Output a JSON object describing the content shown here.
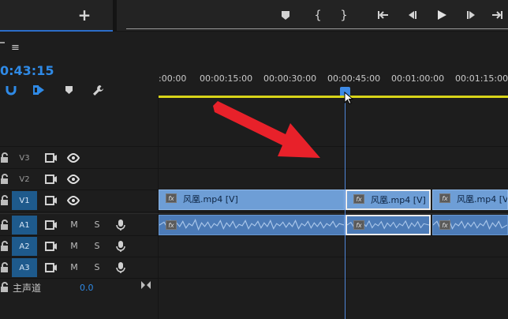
{
  "toolbar": {
    "add_glyph": "+",
    "marker_glyph": "⬥",
    "mark_in_glyph": "{",
    "mark_out_glyph": "}",
    "goto_in_glyph": "{←",
    "step_back_glyph": "◀|",
    "play_glyph": "▶",
    "step_forward_glyph": "|▶",
    "goto_out_glyph": "→}"
  },
  "timeline": {
    "menu_glyph": "≡",
    "timecode": "0:43:15",
    "ruler_labels": [
      ":00:00",
      "00:00:15:00",
      "00:00:30:00",
      "00:00:45:00",
      "00:01:00:00",
      "00:01:15:00"
    ]
  },
  "tracks": {
    "video": [
      {
        "name": "V3",
        "targeted": false
      },
      {
        "name": "V2",
        "targeted": false
      },
      {
        "name": "V1",
        "targeted": true
      }
    ],
    "audio": [
      {
        "name": "A1",
        "mute": "M",
        "solo": "S"
      },
      {
        "name": "A2",
        "mute": "M",
        "solo": "S"
      },
      {
        "name": "A3",
        "mute": "M",
        "solo": "S"
      }
    ],
    "master": {
      "label": "主声道",
      "value": "0.0"
    }
  },
  "clips": {
    "video": [
      {
        "label": "风凰.mp4 [V]",
        "fx": "fx"
      },
      {
        "label": "风凰.mp4 [V]",
        "fx": "fx"
      },
      {
        "label": "风凰.mp4 [V]",
        "fx": "fx"
      }
    ],
    "audio_fx": "fx"
  },
  "colors": {
    "accent": "#2f8ae6",
    "work_area_bar": "#d8d419",
    "video_clip": "#6e9ed6",
    "audio_clip": "#4c7bb7",
    "annotation_arrow": "#e8212a"
  },
  "icons": {
    "snap": "magnet-icon",
    "linked": "linked-selection-icon",
    "marker": "marker-icon",
    "settings": "wrench-icon",
    "lock": "lock-icon",
    "sync": "film-icon",
    "visibility": "eye-icon",
    "voiceover": "mic-icon",
    "pointer": "cursor-icon",
    "annotation": "red-arrow"
  }
}
